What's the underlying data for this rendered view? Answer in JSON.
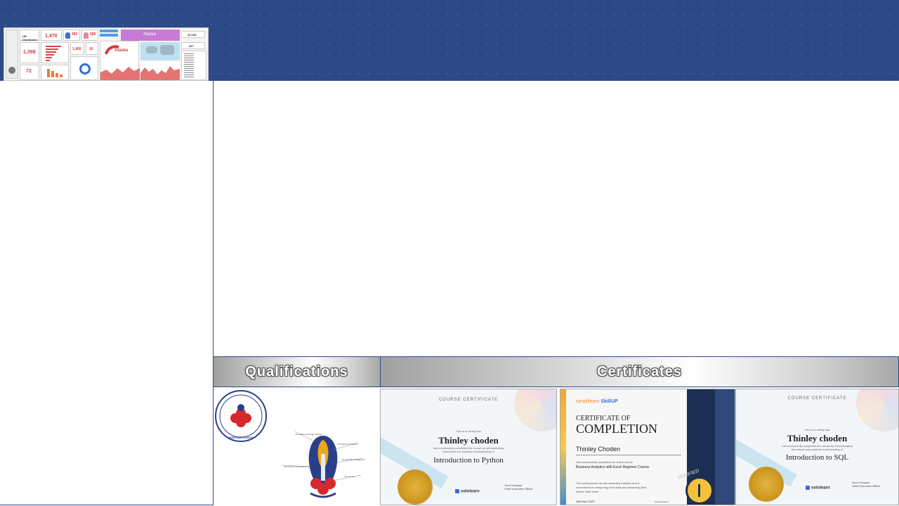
{
  "sections": {
    "qualifications": "Qualifications",
    "certificates": "Certificates"
  },
  "dashboard": {
    "title": "HR Dashboard",
    "kpi_1": "1,470",
    "kpi_2": "962",
    "kpi_3": "588",
    "kpi_4": "1,398",
    "kpi_5": "72",
    "kpi_6": "1,460",
    "kpi_7": "10",
    "banner": "Alaska",
    "map_label": "Alaska",
    "kpi_8": "40.15K",
    "kpi_9": "$37"
  },
  "school": {
    "name": "MOEN HIGH SCHOOL"
  },
  "emblem": {
    "label_1": "The Silken & Orange Rubber",
    "label_2": "The Sword of Wisdom",
    "label_3": "The Twelve Point Diamond Bond",
    "label_4": "The Fire Blue Bodyguard",
    "label_5": "The Crown"
  },
  "certs": {
    "python": {
      "header": "COURSE CERTIFICATE",
      "intro": "This is to certify that",
      "name": "Thinley choden",
      "desc": "has successfully completed the course by demonstrating theoretical and practical understanding of",
      "course": "Introduction to Python",
      "brand": "sololearn",
      "signer": "Yeva Hovsyan",
      "role": "Chief Executive Officer"
    },
    "excel": {
      "brand_a": "simplilearn",
      "brand_b": "SkillUP",
      "title_1": "CERTIFICATE OF",
      "title_2": "COMPLETION",
      "name": "Thinley Choden",
      "line": "Has successfully completed the online course",
      "course": "Business Analytics with Excel Beginner Course",
      "desc": "This professional has demonstrated initiative and a commitment to deepening their skills and advancing their career. Well done!",
      "date": "10th Nov 2023",
      "signer": "Krishna Kumar",
      "stamp": "VERIFIED"
    },
    "sql": {
      "header": "COURSE CERTIFICATE",
      "intro": "This is to certify that",
      "name": "Thinley choden",
      "desc": "has successfully completed the course by demonstrating theoretical and practical understanding of",
      "course": "Introduction to SQL",
      "brand": "sololearn",
      "signer": "Yeva Hovsyan",
      "role": "Chief Executive Officer"
    }
  }
}
